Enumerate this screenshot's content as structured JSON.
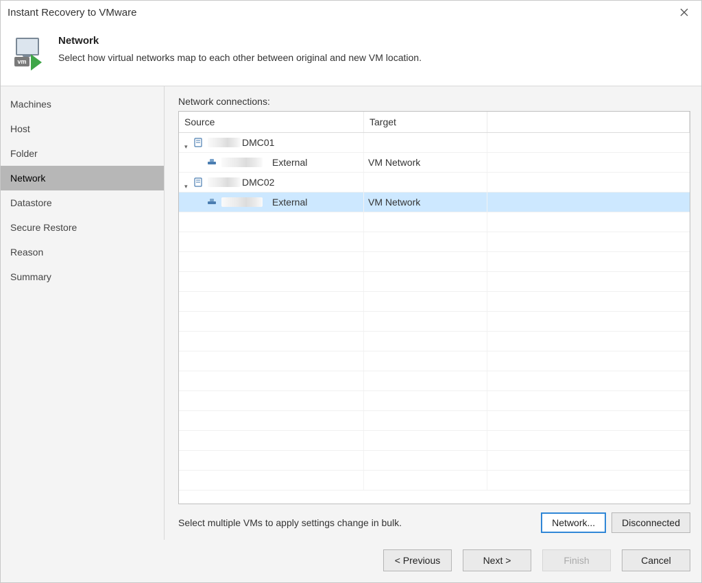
{
  "window": {
    "title": "Instant Recovery to VMware"
  },
  "header": {
    "title": "Network",
    "subtitle": "Select how virtual networks map to each other between original and new VM location.",
    "vm_badge": "vm"
  },
  "sidebar": {
    "items": [
      {
        "label": "Machines",
        "name": "sidebar-item-machines"
      },
      {
        "label": "Host",
        "name": "sidebar-item-host"
      },
      {
        "label": "Folder",
        "name": "sidebar-item-folder"
      },
      {
        "label": "Network",
        "name": "sidebar-item-network"
      },
      {
        "label": "Datastore",
        "name": "sidebar-item-datastore"
      },
      {
        "label": "Secure Restore",
        "name": "sidebar-item-secure-restore"
      },
      {
        "label": "Reason",
        "name": "sidebar-item-reason"
      },
      {
        "label": "Summary",
        "name": "sidebar-item-summary"
      }
    ],
    "active_index": 3
  },
  "main": {
    "panel_label": "Network connections:",
    "columns": {
      "source": "Source",
      "target": "Target"
    },
    "rows": [
      {
        "type": "host",
        "source_suffix": "DMC01",
        "target": ""
      },
      {
        "type": "network",
        "source_suffix": "External",
        "target": "VM Network"
      },
      {
        "type": "host",
        "source_suffix": "DMC02",
        "target": ""
      },
      {
        "type": "network",
        "source_suffix": "External",
        "target": "VM Network",
        "selected": true
      }
    ],
    "hint": "Select multiple VMs to apply settings change in bulk.",
    "buttons": {
      "network": "Network...",
      "disconnected": "Disconnected"
    }
  },
  "footer": {
    "previous": "< Previous",
    "next": "Next >",
    "finish": "Finish",
    "cancel": "Cancel"
  }
}
